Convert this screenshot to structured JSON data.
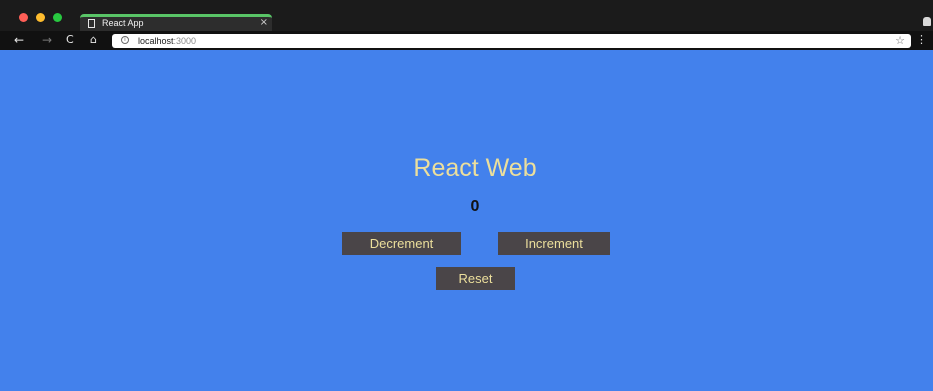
{
  "browser": {
    "tab_title": "React App",
    "tab_close": "×",
    "address": {
      "host": "localhost",
      "port": ":3000"
    },
    "icons": {
      "back": "arrow-left-icon",
      "forward": "arrow-right-icon",
      "reload": "reload-icon",
      "home": "home-icon",
      "info": "info-icon",
      "bookmark": "star-icon",
      "menu": "kebab-menu-icon",
      "profile": "profile-icon"
    }
  },
  "app": {
    "title": "React Web",
    "count": "0",
    "buttons": {
      "decrement": "Decrement",
      "increment": "Increment",
      "reset": "Reset"
    }
  },
  "colors": {
    "page_background": "#4381ec",
    "title_text": "#ecdf9c",
    "button_background": "#4a4548",
    "button_text": "#ecdf9c",
    "count_text": "#111111"
  }
}
